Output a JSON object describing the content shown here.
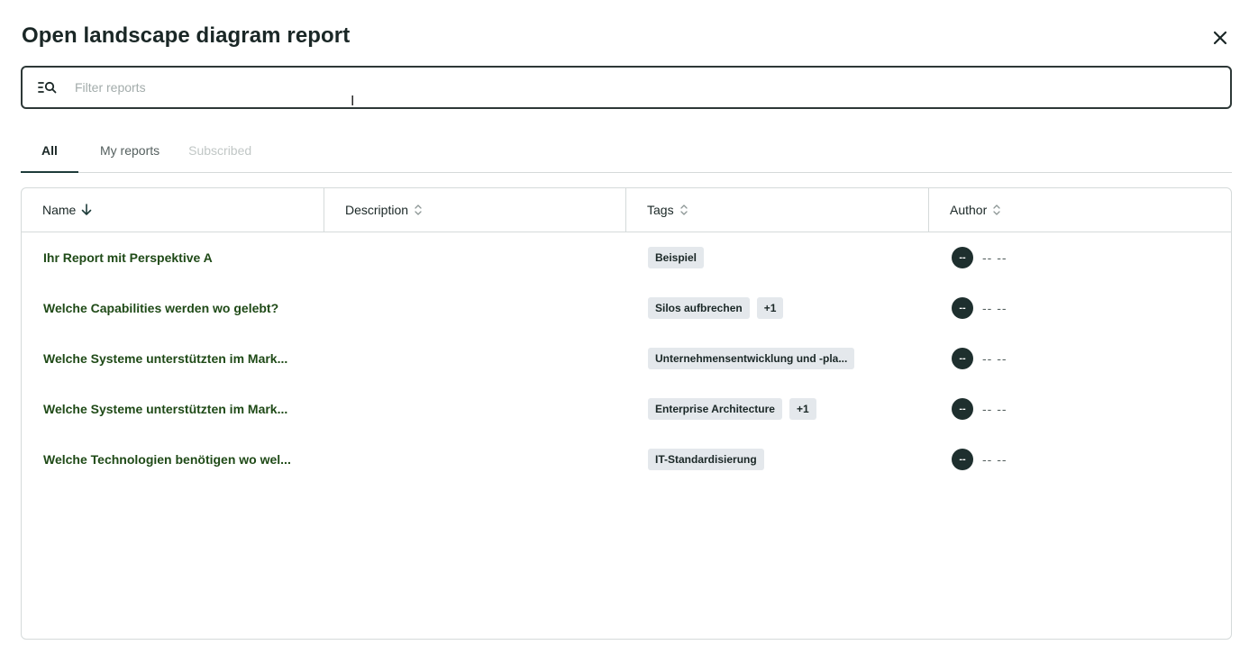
{
  "dialog": {
    "title": "Open landscape diagram report",
    "close_icon": "close-icon"
  },
  "search": {
    "placeholder": "Filter reports",
    "value": "",
    "icon": "filter-search-icon"
  },
  "tabs": [
    {
      "label": "All",
      "active": true
    },
    {
      "label": "My reports",
      "active": false
    },
    {
      "label": "Subscribed",
      "active": false,
      "disabled": true
    }
  ],
  "table": {
    "columns": [
      {
        "label": "Name",
        "sort": "descending",
        "sort_icon": "arrow-down-icon"
      },
      {
        "label": "Description",
        "sort": "none",
        "sort_icon": "sort-icon"
      },
      {
        "label": "Tags",
        "sort": "none",
        "sort_icon": "sort-icon"
      },
      {
        "label": "Author",
        "sort": "none",
        "sort_icon": "sort-icon"
      }
    ],
    "rows": [
      {
        "name": "Ihr Report mit Perspektive A",
        "description": "",
        "tags": [
          "Beispiel"
        ],
        "author_initials": "--",
        "author_name": "-- --"
      },
      {
        "name": "Welche Capabilities werden wo gelebt?",
        "description": "",
        "tags": [
          "Silos aufbrechen",
          "+1"
        ],
        "author_initials": "--",
        "author_name": "-- --"
      },
      {
        "name": "Welche Systeme unterstützten im Mark...",
        "description": "",
        "tags": [
          "Unternehmensentwicklung und -pla..."
        ],
        "author_initials": "--",
        "author_name": "-- --"
      },
      {
        "name": "Welche Systeme unterstützten im Mark...",
        "description": "",
        "tags": [
          "Enterprise Architecture",
          "+1"
        ],
        "author_initials": "--",
        "author_name": "-- --"
      },
      {
        "name": "Welche Technologien benötigen wo wel...",
        "description": "",
        "tags": [
          "IT-Standardisierung"
        ],
        "author_initials": "--",
        "author_name": "-- --"
      }
    ]
  },
  "colors": {
    "link_green": "#1f4a17",
    "avatar_bg": "#1e2f2e",
    "tag_bg": "#e4e8ec",
    "border": "#d5dada"
  }
}
